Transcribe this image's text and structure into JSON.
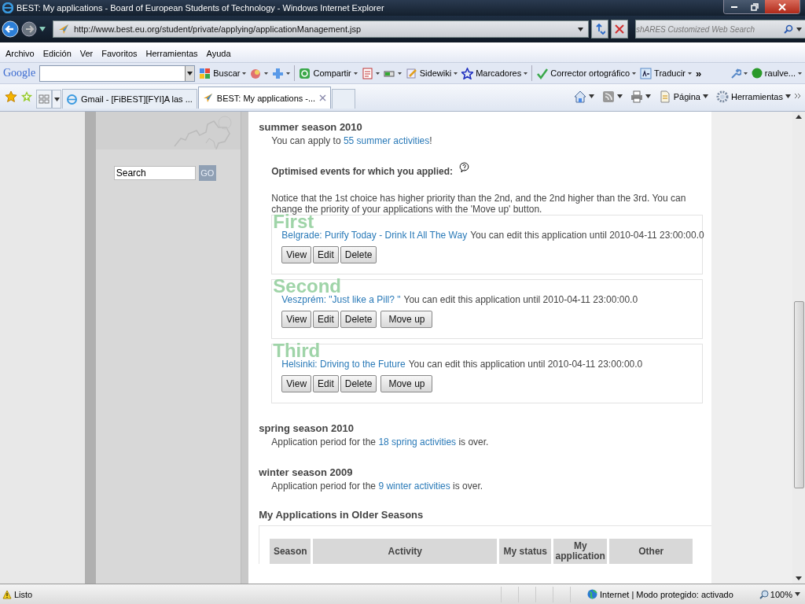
{
  "window": {
    "title": "BEST: My applications - Board of European Students of Technology - Windows Internet Explorer"
  },
  "navigation": {
    "address": "http://www.best.eu.org/student/private/applying/applicationManagement.jsp",
    "search_placeholder": "shARES Customized Web Search"
  },
  "menu_bar": [
    "Archivo",
    "Edición",
    "Ver",
    "Favoritos",
    "Herramientas",
    "Ayuda"
  ],
  "google_toolbar": {
    "logo": "Google",
    "items": [
      {
        "label": "Buscar",
        "dropdown": true
      },
      {
        "dropdown": true
      },
      {
        "dropdown": true
      },
      {
        "label": "Compartir",
        "dropdown": true
      },
      {
        "dropdown": true
      },
      {
        "dropdown": true
      },
      {
        "label": "Sidewiki",
        "dropdown": true
      },
      {
        "label": "Marcadores",
        "dropdown": true
      },
      {
        "label": "Corrector ortográfico",
        "dropdown": true
      },
      {
        "label": "Traducir",
        "dropdown": true
      }
    ],
    "more": "»",
    "account": "raulve..."
  },
  "tabs": [
    {
      "title": "Gmail - [FiBEST][FYI]A las ...",
      "selected": false
    },
    {
      "title": "BEST: My applications -...",
      "selected": true
    }
  ],
  "command_bar": [
    {
      "dropdown": true
    },
    {
      "dropdown": true
    },
    {
      "dropdown": true
    },
    {
      "label": "Página",
      "dropdown": true
    },
    {
      "label": "Herramientas",
      "dropdown": true
    }
  ],
  "sidebar": {
    "search_value": "Search",
    "go": "GO"
  },
  "seasons": [
    {
      "heading": "summer season 2010",
      "before": "You can apply to ",
      "link": "55 summer activities",
      "after": "!",
      "optimised": {
        "heading": "Optimised events for which you applied:",
        "notice": "Notice that the 1st choice has higher priority than the 2nd, and the 2nd higher than the 3rd. You can change the priority of your applications with the 'Move up' button.",
        "applications": [
          {
            "rank": "First",
            "event": "Belgrade: Purify Today - Drink It All The Way",
            "note": "You can edit this application until 2010-04-11 23:00:00.0",
            "buttons": [
              "View",
              "Edit",
              "Delete"
            ]
          },
          {
            "rank": "Second",
            "event": "Veszprém: \"Just like a Pill? \"",
            "note": "You can edit this application until 2010-04-11 23:00:00.0",
            "buttons": [
              "View",
              "Edit",
              "Delete",
              "Move up"
            ]
          },
          {
            "rank": "Third",
            "event": "Helsinki: Driving to the Future",
            "note": "You can edit this application until 2010-04-11 23:00:00.0",
            "buttons": [
              "View",
              "Edit",
              "Delete",
              "Move up"
            ]
          }
        ]
      }
    },
    {
      "heading": "spring season 2010",
      "before": "Application period for the ",
      "link": "18 spring activities",
      "after": " is over."
    },
    {
      "heading": "winter season 2009",
      "before": "Application period for the ",
      "link": "9 winter activities",
      "after": " is over."
    }
  ],
  "older": {
    "heading": "My Applications in Older Seasons",
    "columns": [
      "Season",
      "Activity",
      "My status",
      "My application",
      "Other"
    ]
  },
  "status_bar": {
    "text": "Listo",
    "zone": "Internet | Modo protegido: activado",
    "zoom": "100%"
  }
}
